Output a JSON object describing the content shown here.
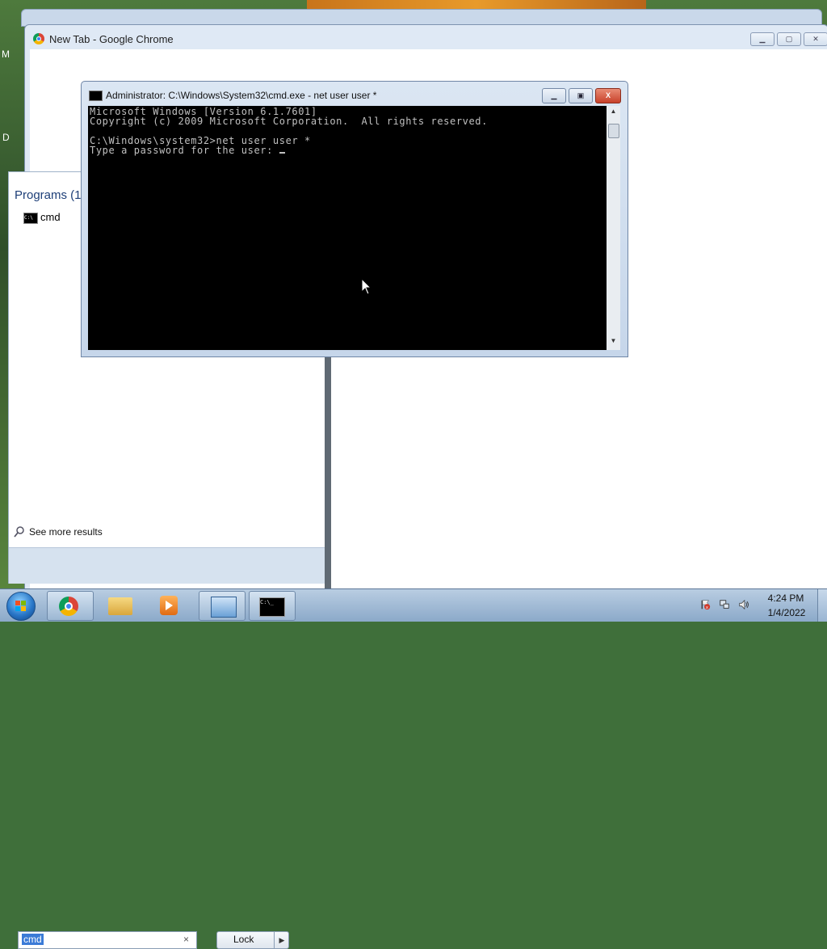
{
  "desktop": {
    "edge_label_1": "M",
    "edge_label_2": "D"
  },
  "chrome": {
    "title": "New Tab - Google Chrome",
    "minimize": "▁",
    "maximize": "▢",
    "close": "✕"
  },
  "start_menu": {
    "programs_heading": "Programs (1)",
    "programs": [
      {
        "label": "cmd",
        "icon": "cmd-icon"
      }
    ],
    "see_more": "See more results",
    "search_value": "cmd",
    "search_clear": "×",
    "lock_label": "Lock",
    "lock_arrow": "▶"
  },
  "cmd_window": {
    "title": "Administrator: C:\\Windows\\System32\\cmd.exe - net  user user *",
    "minimize": "▁",
    "maximize": "▣",
    "close": "X",
    "lines": [
      "Microsoft Windows [Version 6.1.7601]",
      "Copyright (c) 2009 Microsoft Corporation.  All rights reserved.",
      "",
      "C:\\Windows\\system32>net user user *",
      "Type a password for the user: "
    ],
    "scroll_up": "▲",
    "scroll_down": "▼"
  },
  "taskbar": {
    "items": [
      "start-orb",
      "chrome",
      "explorer",
      "media-player",
      "control-panel",
      "cmd"
    ],
    "cmd_icon_text": "C:\\_",
    "clock_time": "4:24 PM",
    "clock_date": "1/4/2022"
  }
}
